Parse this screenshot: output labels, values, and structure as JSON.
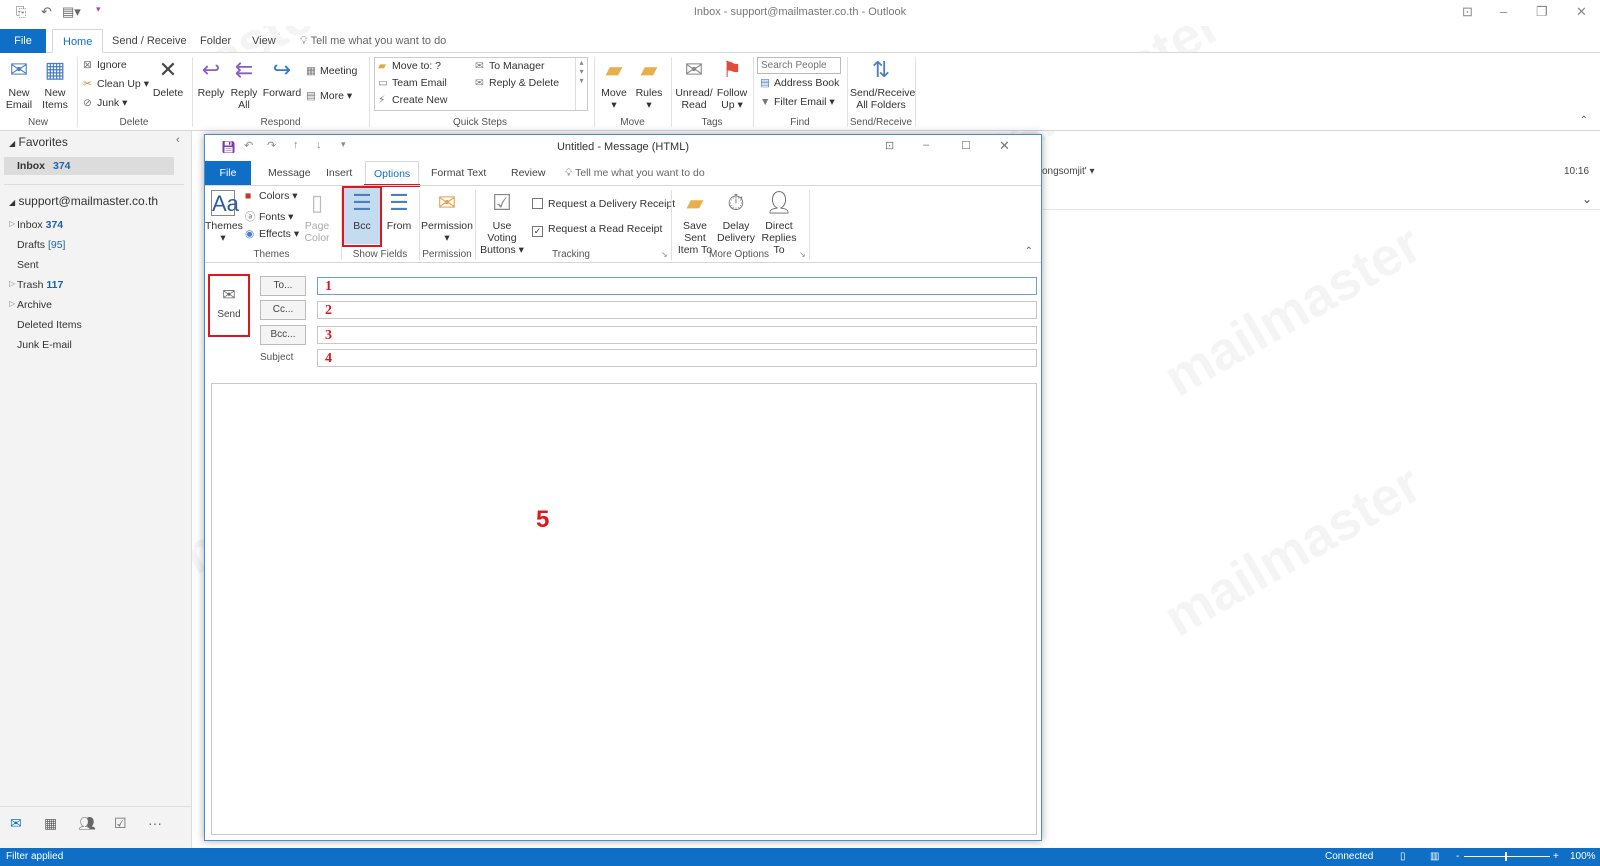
{
  "window": {
    "title": "Inbox - support@mailmaster.co.th  -  Outlook"
  },
  "main_tabs": [
    "File",
    "Home",
    "Send / Receive",
    "Folder",
    "View"
  ],
  "tell_me": "Tell me what you want to do",
  "ribbon": {
    "new": {
      "new_email": "New Email",
      "new_items": "New Items",
      "label": "New"
    },
    "delete": {
      "ignore": "Ignore",
      "clean_up": "Clean Up",
      "junk": "Junk",
      "delete": "Delete",
      "label": "Delete"
    },
    "respond": {
      "reply": "Reply",
      "reply_all": "Reply All",
      "forward": "Forward",
      "meeting": "Meeting",
      "more": "More",
      "label": "Respond"
    },
    "quick_steps": {
      "items": [
        "Move to: ?",
        "Team Email",
        "Create New",
        "To Manager",
        "Reply & Delete"
      ],
      "label": "Quick Steps"
    },
    "move": {
      "move": "Move",
      "rules": "Rules",
      "label": "Move"
    },
    "tags": {
      "unread": "Unread/ Read",
      "follow_up": "Follow Up",
      "label": "Tags"
    },
    "find": {
      "search_placeholder": "Search People",
      "address_book": "Address Book",
      "filter_email": "Filter Email",
      "label": "Find"
    },
    "send_receive": {
      "all": "Send/Receive All Folders",
      "label": "Send/Receive"
    }
  },
  "sidebar": {
    "favorites": "Favorites",
    "fav_inbox": {
      "label": "Inbox",
      "count": "374"
    },
    "account": "support@mailmaster.co.th",
    "folders": [
      {
        "label": "Inbox",
        "count": "374"
      },
      {
        "label": "Drafts",
        "count": "[95]"
      },
      {
        "label": "Sent",
        "count": ""
      },
      {
        "label": "Trash",
        "count": "117"
      },
      {
        "label": "Archive",
        "count": ""
      },
      {
        "label": "Deleted Items",
        "count": ""
      },
      {
        "label": "Junk E-mail",
        "count": ""
      }
    ]
  },
  "reading": {
    "sender": "ongsomjit'",
    "time": "10:16"
  },
  "compose": {
    "title": "Untitled  -  Message (HTML)",
    "tabs": [
      "File",
      "Message",
      "Insert",
      "Options",
      "Format Text",
      "Review"
    ],
    "tell_me": "Tell me what you want to do",
    "themes": {
      "themes": "Themes",
      "colors": "Colors",
      "fonts": "Fonts",
      "effects": "Effects",
      "page_color": "Page Color",
      "label": "Themes"
    },
    "show_fields": {
      "bcc": "Bcc",
      "from": "From",
      "label": "Show Fields"
    },
    "permission": {
      "permission": "Permission",
      "label": "Permission"
    },
    "tracking": {
      "voting": "Use Voting Buttons",
      "delivery_receipt": "Request a Delivery Receipt",
      "delivery_checked": false,
      "read_receipt": "Request a Read Receipt",
      "read_checked": true,
      "label": "Tracking"
    },
    "more_options": {
      "save_sent": "Save Sent Item To",
      "delay": "Delay Delivery",
      "direct": "Direct Replies To",
      "label": "More Options"
    },
    "send": "Send",
    "to": "To...",
    "cc": "Cc...",
    "bcc": "Bcc...",
    "subject": "Subject",
    "markers": [
      "1",
      "2",
      "3",
      "4",
      "5"
    ]
  },
  "status": {
    "left": "Filter applied",
    "connected": "Connected",
    "zoom": "100%"
  },
  "watermark": "mailmaster",
  "colors": {
    "accent": "#0f6fc6",
    "highlight": "#e0161e"
  }
}
